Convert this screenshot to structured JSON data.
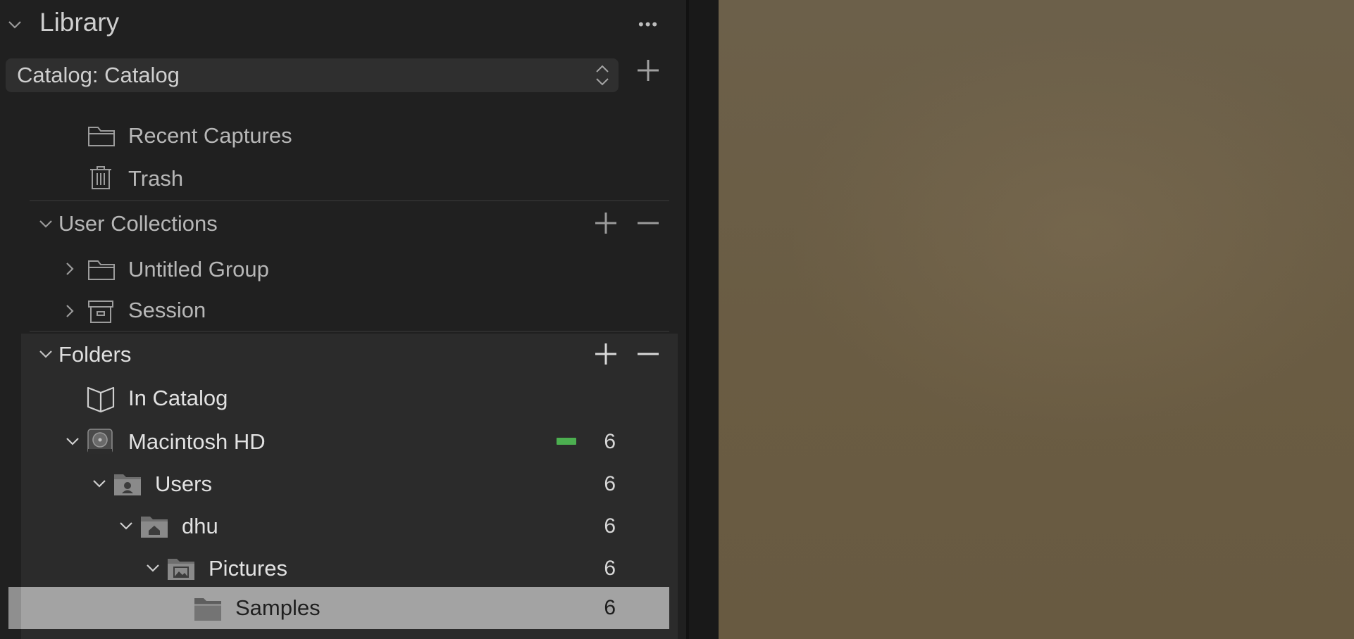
{
  "library": {
    "title": "Library",
    "more_glyph": "•••"
  },
  "catalog_select": {
    "value": "Catalog: Catalog"
  },
  "catalog_items": [
    {
      "label": "Recent Captures",
      "icon": "folder-icon"
    },
    {
      "label": "Trash",
      "icon": "trash-icon"
    }
  ],
  "user_collections": {
    "title": "User Collections",
    "items": [
      {
        "label": "Untitled Group",
        "icon": "folder-icon"
      },
      {
        "label": "Session",
        "icon": "session-box-icon"
      }
    ]
  },
  "folders": {
    "title": "Folders",
    "items": [
      {
        "label": "In Catalog",
        "icon": "open-book-icon",
        "count": ""
      },
      {
        "label": "Macintosh HD",
        "icon": "hard-drive-icon",
        "count": "6",
        "status_color": "#4caf50"
      },
      {
        "label": "Users",
        "icon": "users-folder-icon",
        "count": "6"
      },
      {
        "label": "dhu",
        "icon": "home-folder-icon",
        "count": "6"
      },
      {
        "label": "Pictures",
        "icon": "pictures-folder-icon",
        "count": "6"
      },
      {
        "label": "Samples",
        "icon": "folder-icon",
        "count": "6",
        "selected": true
      }
    ]
  },
  "colors": {
    "selected_row": "#a3a3a3",
    "folders_panel": "#2b2b2b",
    "status_green": "#4caf50"
  }
}
